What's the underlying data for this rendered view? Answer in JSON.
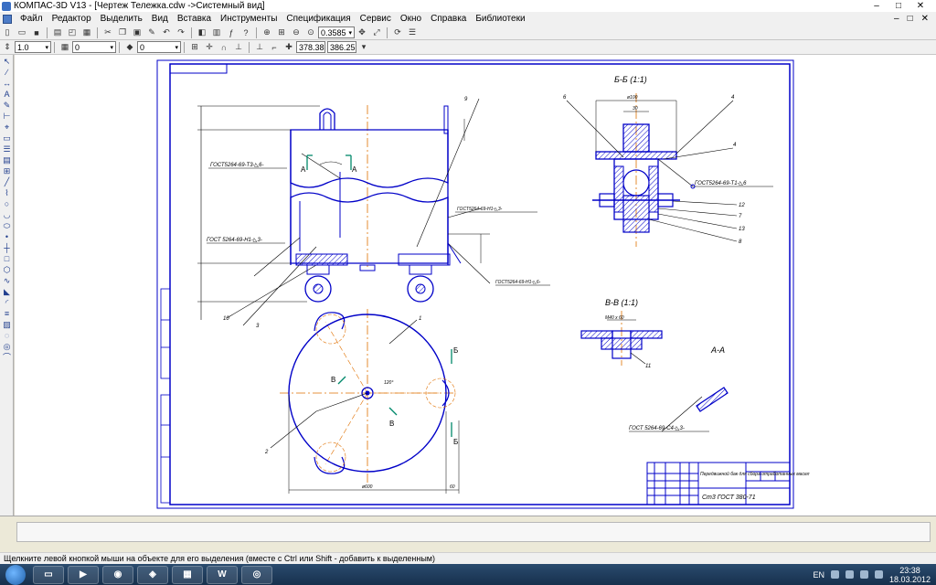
{
  "window": {
    "title": "КОМПАС-3D V13 - [Чертеж  Тележка.cdw ->Системный вид]",
    "min": "–",
    "max": "□",
    "close": "✕"
  },
  "menu": [
    "Файл",
    "Редактор",
    "Выделить",
    "Вид",
    "Вставка",
    "Инструменты",
    "Спецификация",
    "Сервис",
    "Окно",
    "Справка",
    "Библиотеки"
  ],
  "toolbar1": {
    "zoom_value": "0.3585"
  },
  "toolbar2": {
    "step_value": "1.0",
    "style_value": "0",
    "layer_value": "0",
    "coord_x": "378.38",
    "coord_y": "386.25"
  },
  "drawing": {
    "sections": {
      "bb": "Б-Б (1:1)",
      "vv": "В-В (1:1)",
      "aa": "А-А"
    },
    "weld_labels": {
      "w1": "ГОСТ5264-69-Т3-◺6-",
      "w2": "ГОСТ 5264-69-Н1-◺3-",
      "w3": "ГОСТ5264-69-Т1-◺6",
      "w4": "ГОСТ 5264-69-С4-◺3-",
      "w5": "ГОСТ5264-69-Н1-◺3-",
      "w6": "ГОСТ5264-69-Н1-◺6-"
    },
    "dims": {
      "d1": "ø600",
      "d2": "60",
      "d3": "ø100",
      "d4": "30",
      "d5": "М40 х 60",
      "d6": "120°"
    },
    "markers": {
      "a_left": "А",
      "a_right": "А",
      "b_top": "Б",
      "b_bottom": "Б",
      "v_left": "В",
      "v_right": "В"
    },
    "pos_numbers": {
      "p1": "1",
      "p2": "2",
      "p3": "3",
      "p4": "4",
      "p6": "6",
      "p7": "7",
      "p8": "8",
      "p9": "9",
      "p10": "10",
      "p11": "11",
      "p12": "12",
      "p13": "13"
    },
    "title_block": {
      "name": "Передвижной бак для сбора отработанных масел",
      "material": "Ст3 ГОСТ 380-71"
    }
  },
  "statusbar": {
    "hint": "Щелкните левой кнопкой мыши на объекте для его выделения (вместе с Ctrl или Shift - добавить к выделенным)"
  },
  "taskbar": {
    "word_label": "W",
    "lang": "EN",
    "time": "23:38",
    "date": "18.03.2012"
  },
  "colors": {
    "outline": "#0000c8",
    "axis": "#e07000",
    "dim": "#000000",
    "hatch": "#0000c8"
  }
}
